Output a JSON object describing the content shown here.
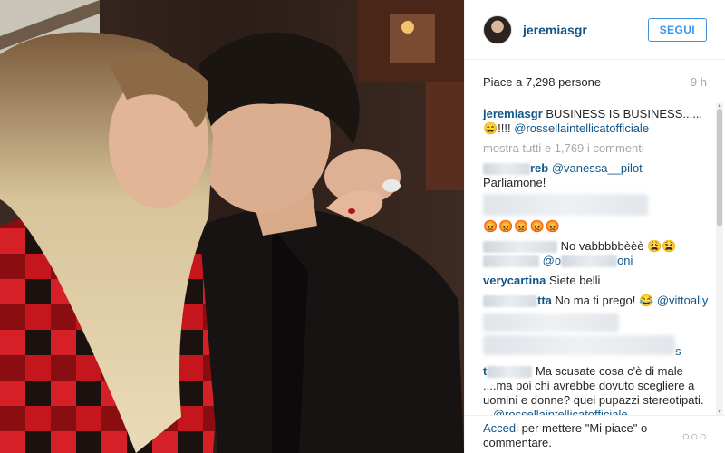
{
  "photo": {
    "description_icon": "photo-icon"
  },
  "header": {
    "username": "jeremiasgr",
    "follow_label": "SEGUI"
  },
  "meta": {
    "likes": "Piace a 7,298 persone",
    "time": "9 h"
  },
  "caption": {
    "user": "jeremiasgr",
    "text": " BUSINESS IS BUSINESS......😄!!!! ",
    "mention": "@rossellaintellicatofficiale"
  },
  "show_all": "mostra tutti e 1,769 i commenti",
  "comments": [
    {
      "user_suffix": "reb",
      "mention": "@vanessa__pilot",
      "text": "Parliamone!"
    },
    {
      "text": "😡😡😡😡😡"
    },
    {
      "text": "No vabbbbbèèè 😩😫",
      "mention_a": "@",
      "mention_b": "@o",
      "mention_c": "oni"
    },
    {
      "user": "verycartina",
      "text": "Siete belli"
    },
    {
      "user_suffix": "tta",
      "text": "No ma ti prego! 😂 ",
      "mention": "@vittoally"
    },
    {
      "user_suffix": "s"
    },
    {
      "user_prefix": "t",
      "text": "Ma scusate cosa c'è di male ....ma poi chi avrebbe dovuto scegliere a uomini e donne? quei pupazzi stereotipati. ...",
      "mention": "@rossellaintellicatofficiale"
    }
  ],
  "footer": {
    "login_link": "Accedi",
    "rest": " per mettere \"Mi piace\" o commentare.",
    "more_icon": "more-horizontal-icon"
  }
}
